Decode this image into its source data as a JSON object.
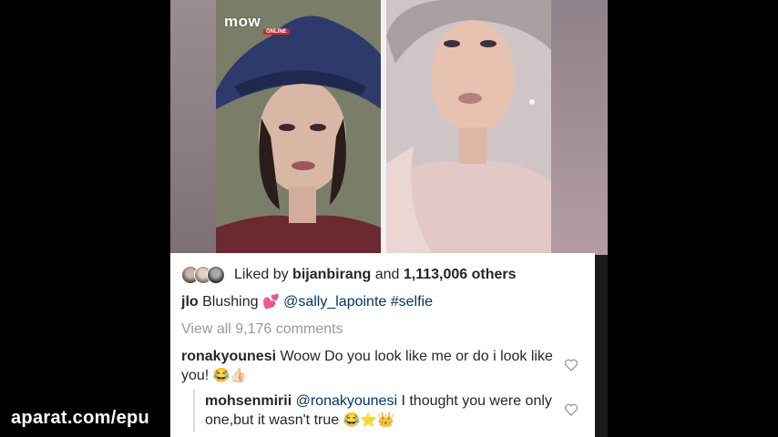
{
  "watermark": {
    "brand": "mow",
    "sub": "ONLINE"
  },
  "post": {
    "likes": {
      "prefix": "Liked by",
      "user": "bijanbirang",
      "middle": "and",
      "count": "1,113,006",
      "suffix": "others"
    },
    "caption": {
      "user": "jlo",
      "text": "Blushing",
      "emoji": "💕",
      "mention": "@sally_lapointe",
      "hashtag": "#selfie"
    },
    "view_all": "View all 9,176 comments",
    "comments": [
      {
        "user": "ronakyounesi",
        "text": "Woow Do you look like me or do i look like you!",
        "emoji": "😂👍🏻"
      },
      {
        "user": "mohsenmirii",
        "mention": "@ronakyounesi",
        "text": "I thought you were only one,but it wasn't true",
        "emoji": "😂⭐👑"
      }
    ]
  },
  "site_watermark": "aparat.com/epu"
}
